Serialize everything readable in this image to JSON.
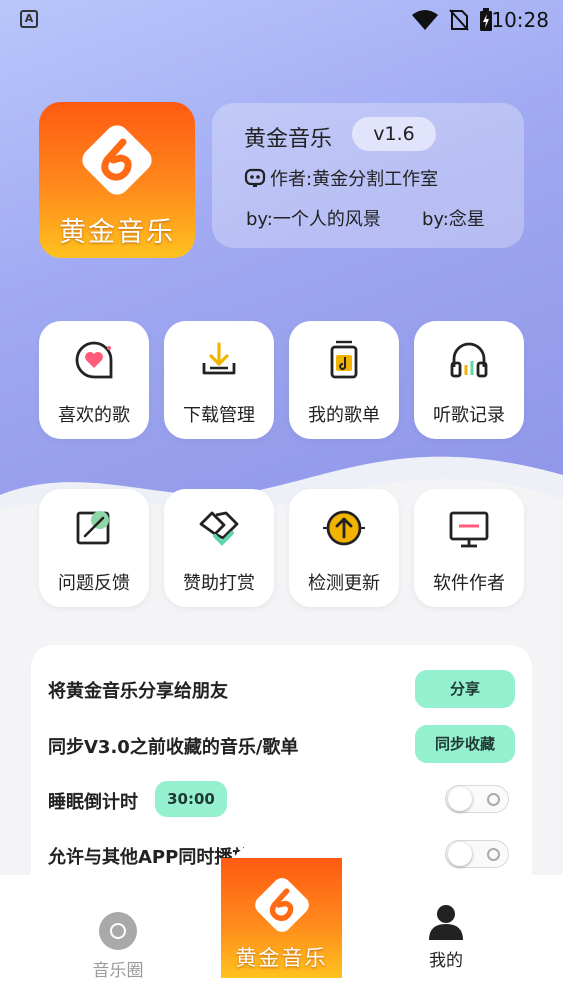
{
  "status_bar": {
    "time": "10:28",
    "notification_icon": "a-icon"
  },
  "app": {
    "logo_text": "黄金音乐",
    "name": "黄金音乐",
    "version": "v1.6",
    "author": "作者:黄金分割工作室",
    "by_1": "by:一个人的风景",
    "by_2": "by:念星"
  },
  "grid": {
    "row1": [
      {
        "label": "喜欢的歌",
        "icon": "heart-chat-icon"
      },
      {
        "label": "下载管理",
        "icon": "download-icon"
      },
      {
        "label": "我的歌单",
        "icon": "playlist-icon"
      },
      {
        "label": "听歌记录",
        "icon": "headphones-icon"
      }
    ],
    "row2": [
      {
        "label": "问题反馈",
        "icon": "feedback-icon"
      },
      {
        "label": "赞助打赏",
        "icon": "handshake-icon"
      },
      {
        "label": "检测更新",
        "icon": "update-icon"
      },
      {
        "label": "软件作者",
        "icon": "monitor-icon"
      }
    ]
  },
  "settings": {
    "share_label": "将黄金音乐分享给朋友",
    "share_button": "分享",
    "sync_label": "同步V3.0之前收藏的音乐/歌单",
    "sync_button": "同步收藏",
    "sleep_label": "睡眠倒计时",
    "sleep_value": "30:00",
    "allow_label": "允许与其他APP同时播放"
  },
  "bottom_nav": {
    "left_label": "音乐圈",
    "center_text": "黄金音乐",
    "right_label": "我的"
  },
  "colors": {
    "accent_green": "#95f0cf",
    "brand_orange": "#ff6a14",
    "brand_yellow": "#ffc21e"
  }
}
